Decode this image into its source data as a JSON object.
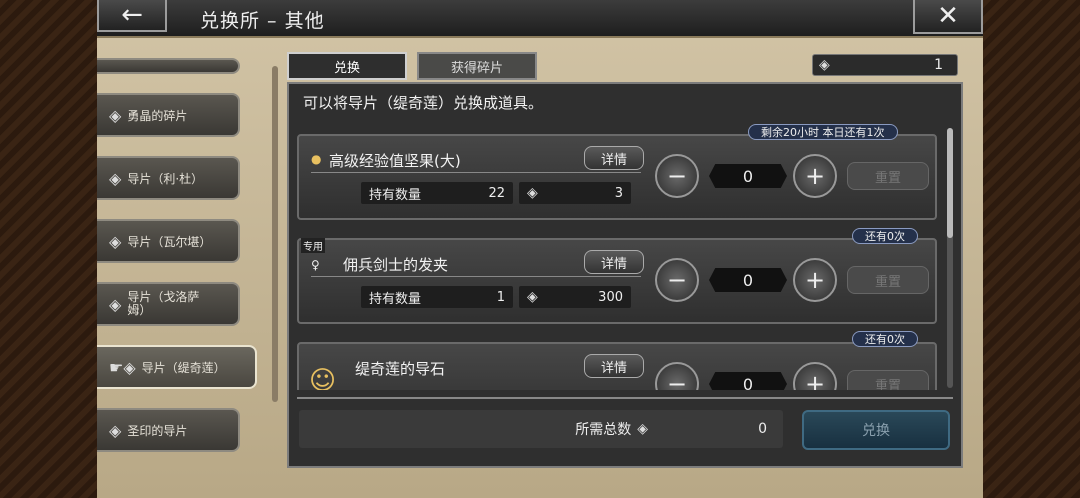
{
  "header": {
    "back_icon": "←",
    "close_icon": "✕",
    "title": "兑换所 – 其他"
  },
  "sidebar": {
    "items": [
      {
        "label": "勇晶的碎片"
      },
      {
        "label": "导片（利·杜）"
      },
      {
        "label": "导片（瓦尔堪）"
      },
      {
        "label": "导片（戈洛萨姆）"
      },
      {
        "label": "导片（缇奇莲）"
      },
      {
        "label": "圣印的导片"
      }
    ]
  },
  "tabs": {
    "exchange": "兑换",
    "obtain": "获得碎片"
  },
  "currency": {
    "value": "1"
  },
  "description": "可以将导片（缇奇莲）兑换成道具。",
  "items": [
    {
      "name": "高级经验值坚果(大)",
      "detail": "详情",
      "holding_label": "持有数量",
      "holding": "22",
      "cost": "3",
      "qty": "0",
      "reset": "重置",
      "limit": "剩余20小时  本日还有1次"
    },
    {
      "name": "佣兵剑士的发夹",
      "detail": "详情",
      "holding_label": "持有数量",
      "holding": "1",
      "cost": "300",
      "qty": "0",
      "reset": "重置",
      "limit": "还有0次",
      "exclusive": "专用"
    },
    {
      "name": "缇奇莲的导石",
      "detail": "详情",
      "qty": "0",
      "reset": "重置",
      "limit": "还有0次"
    }
  ],
  "footer": {
    "label": "所需总数",
    "value": "0",
    "exchange": "兑换"
  }
}
